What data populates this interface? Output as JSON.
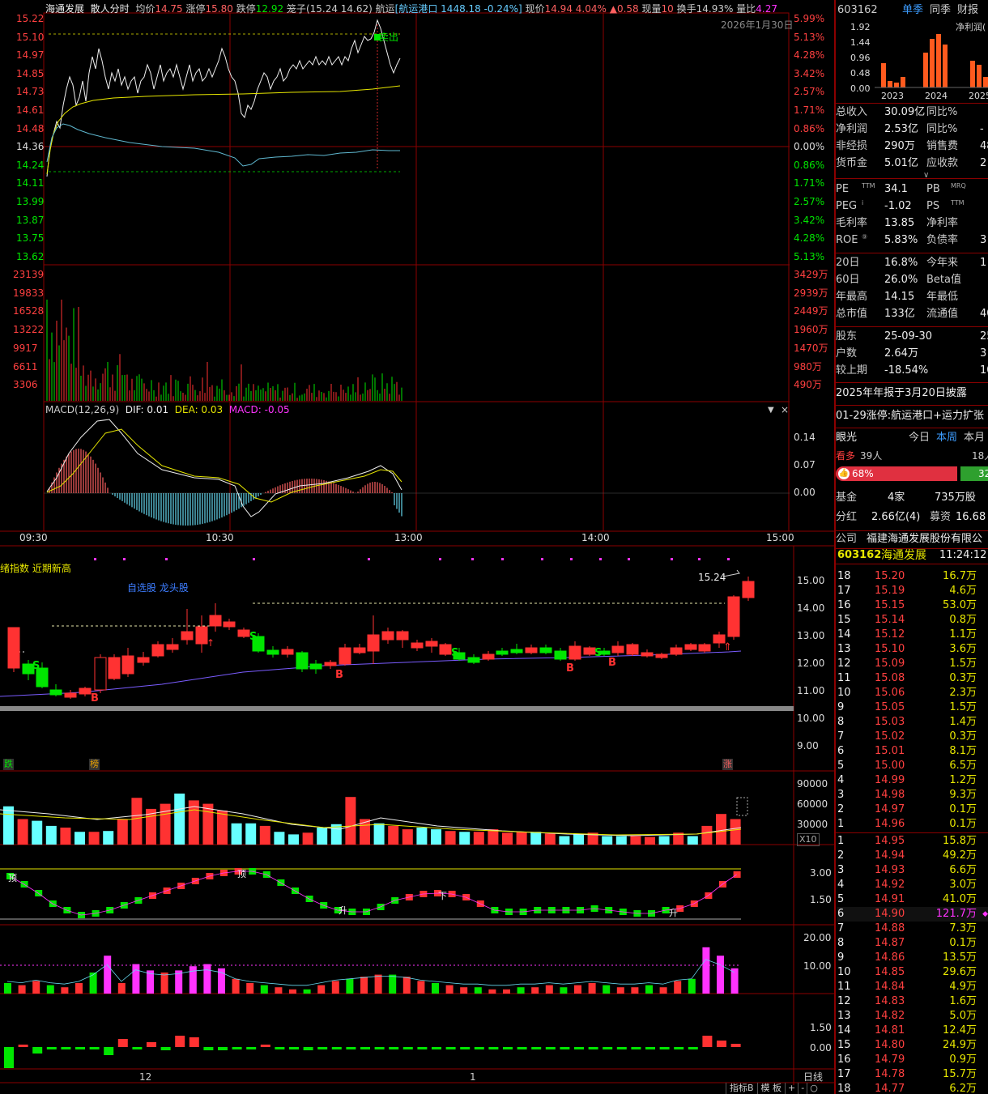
{
  "intraday_header": {
    "name": "海通发展",
    "mode": "散人分时",
    "avg_label": "均价",
    "avg": "14.75",
    "limit_up_label": "涨停",
    "limit_up": "15.80",
    "limit_down_label": "跌停",
    "limit_down": "12.92",
    "cage_label": "笼子",
    "cage": "(15.24 14.62)",
    "sector_label": "航运",
    "sector": "[航运港口 1448.18 -0.24%]",
    "price_label": "现价",
    "price": "14.94",
    "pct": "4.04%",
    "change": "▲0.58",
    "vol_label": "现量",
    "vol": "10",
    "turnover_label": "换手",
    "turnover": "14.93%",
    "ratio_label": "量比",
    "ratio": "4.27"
  },
  "intraday_date": "2026年1月30日",
  "price_axis_left": [
    "15.22",
    "15.10",
    "14.97",
    "14.85",
    "14.73",
    "14.61",
    "14.48",
    "14.36",
    "14.24",
    "14.11",
    "13.99",
    "13.87",
    "13.75",
    "13.62"
  ],
  "price_axis_right": [
    "5.99%",
    "5.13%",
    "4.28%",
    "3.42%",
    "2.57%",
    "1.71%",
    "0.86%",
    "0.00%",
    "0.86%",
    "1.71%",
    "2.57%",
    "3.42%",
    "4.28%",
    "5.13%"
  ],
  "vol_axis_left": [
    "23139",
    "19833",
    "16528",
    "13222",
    "9917",
    "6611",
    "3306"
  ],
  "vol_axis_right": [
    "3429万",
    "2939万",
    "2449万",
    "1960万",
    "1470万",
    "980万",
    "490万"
  ],
  "macd_header": {
    "label": "MACD(12,26,9)",
    "dif": "DIF: 0.01",
    "dea": "DEA: 0.03",
    "macd": "MACD: -0.05"
  },
  "macd_axis": [
    "0.14",
    "0.07",
    "0.00"
  ],
  "macd_controls": {
    "down": "▼",
    "close": "×"
  },
  "time_axis": [
    "09:30",
    "10:30",
    "13:00",
    "14:00",
    "15:00"
  ],
  "signal_label": "卖出",
  "stock_info": {
    "code": "603162",
    "tabs": [
      "单季",
      "同季",
      "财报"
    ],
    "mini_axis": [
      "1.92",
      "1.44",
      "0.96",
      "0.48",
      "0.00"
    ],
    "mini_years": [
      "2023",
      "2024",
      "2025"
    ],
    "mini_title": "净利润(",
    "rows1": [
      {
        "k": "总收入",
        "v": "30.09亿",
        "k2": "同比%",
        "v2": ""
      },
      {
        "k": "净利润",
        "v": "2.53亿",
        "k2": "同比%",
        "v2": "-"
      },
      {
        "k": "非经损",
        "v": "290万",
        "k2": "销售费",
        "v2": "48"
      },
      {
        "k": "货币金",
        "v": "5.01亿",
        "k2": "应收款",
        "v2": "2"
      }
    ],
    "rows2": [
      {
        "k": "PE",
        "sup": "TTM",
        "v": "34.1",
        "k2": "PB",
        "sup2": "MRQ",
        "v2": ""
      },
      {
        "k": "PEG",
        "sup": "i",
        "v": "-1.02",
        "k2": "PS",
        "sup2": "TTM",
        "v2": ""
      },
      {
        "k": "毛利率",
        "sup": "",
        "v": "13.85",
        "k2": "净利率",
        "sup2": "",
        "v2": ""
      },
      {
        "k": "ROE",
        "sup": "⑨",
        "v": "5.83%",
        "k2": "负债率",
        "sup2": "",
        "v2": "3"
      }
    ],
    "rows3": [
      {
        "k": "20日",
        "v": "16.8%",
        "k2": "今年来",
        "v2": "1"
      },
      {
        "k": "60日",
        "v": "26.0%",
        "k2": "Beta值",
        "v2": ""
      },
      {
        "k": "年最高",
        "v": "14.15",
        "k2": "年最低",
        "v2": ""
      },
      {
        "k": "总市值",
        "v": "133亿",
        "k2": "流通值",
        "v2": "40"
      }
    ],
    "rows4": [
      {
        "k": "股东",
        "v": "25-09-30",
        "v2": "25-"
      },
      {
        "k": "户数",
        "v": "2.64万",
        "v2": "3"
      },
      {
        "k": "较上期",
        "v": "-18.54%",
        "v2": "10"
      }
    ],
    "report": "2025年年报于3月20日披露",
    "limit_news": "01-29涨停:航运港口+运力扩张",
    "eye_label": "眼光",
    "eye_tabs": [
      "今日",
      "本周",
      "本月"
    ],
    "bull_label": "看多",
    "bull_count": "39人",
    "right_count": "18人",
    "bull_pct": "68%",
    "bear_pct": "32",
    "fund_label": "基金",
    "fund_count": "4家",
    "fund_shares": "735万股",
    "div_label": "分红",
    "div_value": "2.66亿(4)",
    "raise_label": "募资",
    "raise_value": "16.68"
  },
  "daily_panel": {
    "title": "绪指数 近期新高",
    "note": "自选股 龙头股",
    "peak_label": "15.24",
    "price_axis": [
      "15.00",
      "14.00",
      "13.00",
      "12.00",
      "11.00",
      "10.00",
      "9.00"
    ],
    "vol_axis": [
      "90000",
      "60000",
      "30000"
    ],
    "vol_unit": "X10",
    "osc1_axis": [
      "3.00",
      "1.50"
    ],
    "osc2_axis": [
      "20.00",
      "10.00"
    ],
    "osc3_axis": [
      "1.50",
      "0.00"
    ],
    "tags": {
      "die": "跌",
      "bang": "榜",
      "zhang": "涨"
    },
    "month_labels": [
      "12",
      "1"
    ],
    "bottom_tabs": [
      "指标B",
      "模 板",
      "+",
      "-",
      "○"
    ],
    "daily_line_label": "日线"
  },
  "company": {
    "label": "公司",
    "name": "福建海通发展股份有限公"
  },
  "tick": {
    "code": "603162",
    "name": "海通发展",
    "time": "11:24:12"
  },
  "order_book": {
    "asks": [
      {
        "n": "18",
        "p": "15.20",
        "v": "16.7万"
      },
      {
        "n": "17",
        "p": "15.19",
        "v": "4.6万"
      },
      {
        "n": "16",
        "p": "15.15",
        "v": "53.0万"
      },
      {
        "n": "15",
        "p": "15.14",
        "v": "0.8万"
      },
      {
        "n": "14",
        "p": "15.12",
        "v": "1.1万"
      },
      {
        "n": "13",
        "p": "15.10",
        "v": "3.6万"
      },
      {
        "n": "12",
        "p": "15.09",
        "v": "1.5万"
      },
      {
        "n": "11",
        "p": "15.08",
        "v": "0.3万"
      },
      {
        "n": "10",
        "p": "15.06",
        "v": "2.3万"
      },
      {
        "n": "9",
        "p": "15.05",
        "v": "1.5万"
      },
      {
        "n": "8",
        "p": "15.03",
        "v": "1.4万"
      },
      {
        "n": "7",
        "p": "15.02",
        "v": "0.3万"
      },
      {
        "n": "6",
        "p": "15.01",
        "v": "8.1万"
      },
      {
        "n": "5",
        "p": "15.00",
        "v": "6.5万"
      },
      {
        "n": "4",
        "p": "14.99",
        "v": "1.2万"
      },
      {
        "n": "3",
        "p": "14.98",
        "v": "9.3万"
      },
      {
        "n": "2",
        "p": "14.97",
        "v": "0.1万"
      },
      {
        "n": "1",
        "p": "14.96",
        "v": "0.1万"
      }
    ],
    "bids": [
      {
        "n": "1",
        "p": "14.95",
        "v": "15.8万"
      },
      {
        "n": "2",
        "p": "14.94",
        "v": "49.2万"
      },
      {
        "n": "3",
        "p": "14.93",
        "v": "6.6万"
      },
      {
        "n": "4",
        "p": "14.92",
        "v": "3.0万"
      },
      {
        "n": "5",
        "p": "14.91",
        "v": "41.0万"
      },
      {
        "n": "6",
        "p": "14.90",
        "v": "121.7万"
      },
      {
        "n": "7",
        "p": "14.88",
        "v": "7.3万"
      },
      {
        "n": "8",
        "p": "14.87",
        "v": "0.1万"
      },
      {
        "n": "9",
        "p": "14.86",
        "v": "13.5万"
      },
      {
        "n": "10",
        "p": "14.85",
        "v": "29.6万"
      },
      {
        "n": "11",
        "p": "14.84",
        "v": "4.9万"
      },
      {
        "n": "12",
        "p": "14.83",
        "v": "1.6万"
      },
      {
        "n": "13",
        "p": "14.82",
        "v": "5.0万"
      },
      {
        "n": "14",
        "p": "14.81",
        "v": "12.4万"
      },
      {
        "n": "15",
        "p": "14.80",
        "v": "24.9万"
      },
      {
        "n": "16",
        "p": "14.79",
        "v": "0.9万"
      },
      {
        "n": "17",
        "p": "14.78",
        "v": "15.7万"
      },
      {
        "n": "18",
        "p": "14.77",
        "v": "6.2万"
      }
    ]
  },
  "colors": {
    "up": "#ff3232",
    "down": "#00e600",
    "grid": "#8b0000",
    "yellow": "#e6e600",
    "cyan": "#66ffff",
    "magenta": "#ff33ff"
  }
}
